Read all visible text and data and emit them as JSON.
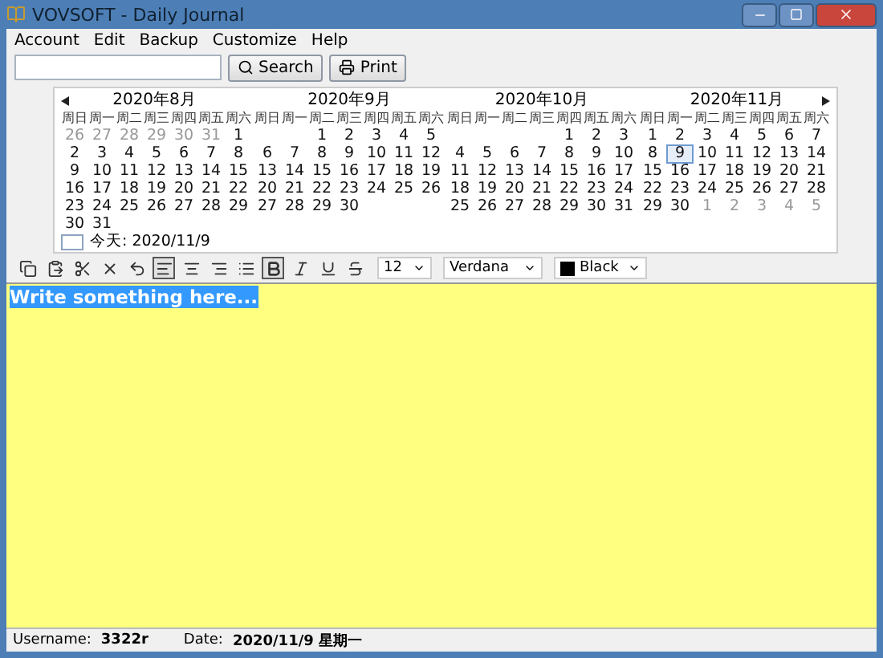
{
  "window": {
    "title": "VOVSOFT - Daily Journal"
  },
  "menu": [
    "Account",
    "Edit",
    "Backup",
    "Customize",
    "Help"
  ],
  "search": {
    "button": "Search"
  },
  "print_button": "Print",
  "calendar": {
    "months": [
      {
        "title": "2020年8月",
        "weekdays": [
          "周日",
          "周一",
          "周二",
          "周三",
          "周四",
          "周五",
          "周六"
        ],
        "weeks": [
          [
            {
              "day": "26",
              "other": true,
              "selected": false
            },
            {
              "day": "27",
              "other": true,
              "selected": false
            },
            {
              "day": "28",
              "other": true,
              "selected": false
            },
            {
              "day": "29",
              "other": true,
              "selected": false
            },
            {
              "day": "30",
              "other": true,
              "selected": false
            },
            {
              "day": "31",
              "other": true,
              "selected": false
            },
            {
              "day": "1",
              "other": false,
              "selected": false
            }
          ],
          [
            {
              "day": "2",
              "other": false,
              "selected": false
            },
            {
              "day": "3",
              "other": false,
              "selected": false
            },
            {
              "day": "4",
              "other": false,
              "selected": false
            },
            {
              "day": "5",
              "other": false,
              "selected": false
            },
            {
              "day": "6",
              "other": false,
              "selected": false
            },
            {
              "day": "7",
              "other": false,
              "selected": false
            },
            {
              "day": "8",
              "other": false,
              "selected": false
            }
          ],
          [
            {
              "day": "9",
              "other": false,
              "selected": false
            },
            {
              "day": "10",
              "other": false,
              "selected": false
            },
            {
              "day": "11",
              "other": false,
              "selected": false
            },
            {
              "day": "12",
              "other": false,
              "selected": false
            },
            {
              "day": "13",
              "other": false,
              "selected": false
            },
            {
              "day": "14",
              "other": false,
              "selected": false
            },
            {
              "day": "15",
              "other": false,
              "selected": false
            }
          ],
          [
            {
              "day": "16",
              "other": false,
              "selected": false
            },
            {
              "day": "17",
              "other": false,
              "selected": false
            },
            {
              "day": "18",
              "other": false,
              "selected": false
            },
            {
              "day": "19",
              "other": false,
              "selected": false
            },
            {
              "day": "20",
              "other": false,
              "selected": false
            },
            {
              "day": "21",
              "other": false,
              "selected": false
            },
            {
              "day": "22",
              "other": false,
              "selected": false
            }
          ],
          [
            {
              "day": "23",
              "other": false,
              "selected": false
            },
            {
              "day": "24",
              "other": false,
              "selected": false
            },
            {
              "day": "25",
              "other": false,
              "selected": false
            },
            {
              "day": "26",
              "other": false,
              "selected": false
            },
            {
              "day": "27",
              "other": false,
              "selected": false
            },
            {
              "day": "28",
              "other": false,
              "selected": false
            },
            {
              "day": "29",
              "other": false,
              "selected": false
            }
          ],
          [
            {
              "day": "30",
              "other": false,
              "selected": false
            },
            {
              "day": "31",
              "other": false,
              "selected": false
            }
          ]
        ]
      },
      {
        "title": "2020年9月",
        "weekdays": [
          "周日",
          "周一",
          "周二",
          "周三",
          "周四",
          "周五",
          "周六"
        ],
        "weeks": [
          [
            {
              "day": "1",
              "other": false,
              "selected": false
            },
            {
              "day": "2",
              "other": false,
              "selected": false
            },
            {
              "day": "3",
              "other": false,
              "selected": false
            },
            {
              "day": "4",
              "other": false,
              "selected": false
            },
            {
              "day": "5",
              "other": false,
              "selected": false
            }
          ],
          [
            {
              "day": "6",
              "other": false,
              "selected": false
            },
            {
              "day": "7",
              "other": false,
              "selected": false
            },
            {
              "day": "8",
              "other": false,
              "selected": false
            },
            {
              "day": "9",
              "other": false,
              "selected": false
            },
            {
              "day": "10",
              "other": false,
              "selected": false
            },
            {
              "day": "11",
              "other": false,
              "selected": false
            },
            {
              "day": "12",
              "other": false,
              "selected": false
            }
          ],
          [
            {
              "day": "13",
              "other": false,
              "selected": false
            },
            {
              "day": "14",
              "other": false,
              "selected": false
            },
            {
              "day": "15",
              "other": false,
              "selected": false
            },
            {
              "day": "16",
              "other": false,
              "selected": false
            },
            {
              "day": "17",
              "other": false,
              "selected": false
            },
            {
              "day": "18",
              "other": false,
              "selected": false
            },
            {
              "day": "19",
              "other": false,
              "selected": false
            }
          ],
          [
            {
              "day": "20",
              "other": false,
              "selected": false
            },
            {
              "day": "21",
              "other": false,
              "selected": false
            },
            {
              "day": "22",
              "other": false,
              "selected": false
            },
            {
              "day": "23",
              "other": false,
              "selected": false
            },
            {
              "day": "24",
              "other": false,
              "selected": false
            },
            {
              "day": "25",
              "other": false,
              "selected": false
            },
            {
              "day": "26",
              "other": false,
              "selected": false
            }
          ],
          [
            {
              "day": "27",
              "other": false,
              "selected": false
            },
            {
              "day": "28",
              "other": false,
              "selected": false
            },
            {
              "day": "29",
              "other": false,
              "selected": false
            },
            {
              "day": "30",
              "other": false,
              "selected": false
            }
          ]
        ]
      },
      {
        "title": "2020年10月",
        "weekdays": [
          "周日",
          "周一",
          "周二",
          "周三",
          "周四",
          "周五",
          "周六"
        ],
        "weeks": [
          [
            {
              "day": "1",
              "other": false,
              "selected": false
            },
            {
              "day": "2",
              "other": false,
              "selected": false
            },
            {
              "day": "3",
              "other": false,
              "selected": false
            }
          ],
          [
            {
              "day": "4",
              "other": false,
              "selected": false
            },
            {
              "day": "5",
              "other": false,
              "selected": false
            },
            {
              "day": "6",
              "other": false,
              "selected": false
            },
            {
              "day": "7",
              "other": false,
              "selected": false
            },
            {
              "day": "8",
              "other": false,
              "selected": false
            },
            {
              "day": "9",
              "other": false,
              "selected": false
            },
            {
              "day": "10",
              "other": false,
              "selected": false
            }
          ],
          [
            {
              "day": "11",
              "other": false,
              "selected": false
            },
            {
              "day": "12",
              "other": false,
              "selected": false
            },
            {
              "day": "13",
              "other": false,
              "selected": false
            },
            {
              "day": "14",
              "other": false,
              "selected": false
            },
            {
              "day": "15",
              "other": false,
              "selected": false
            },
            {
              "day": "16",
              "other": false,
              "selected": false
            },
            {
              "day": "17",
              "other": false,
              "selected": false
            }
          ],
          [
            {
              "day": "18",
              "other": false,
              "selected": false
            },
            {
              "day": "19",
              "other": false,
              "selected": false
            },
            {
              "day": "20",
              "other": false,
              "selected": false
            },
            {
              "day": "21",
              "other": false,
              "selected": false
            },
            {
              "day": "22",
              "other": false,
              "selected": false
            },
            {
              "day": "23",
              "other": false,
              "selected": false
            },
            {
              "day": "24",
              "other": false,
              "selected": false
            }
          ],
          [
            {
              "day": "25",
              "other": false,
              "selected": false
            },
            {
              "day": "26",
              "other": false,
              "selected": false
            },
            {
              "day": "27",
              "other": false,
              "selected": false
            },
            {
              "day": "28",
              "other": false,
              "selected": false
            },
            {
              "day": "29",
              "other": false,
              "selected": false
            },
            {
              "day": "30",
              "other": false,
              "selected": false
            },
            {
              "day": "31",
              "other": false,
              "selected": false
            }
          ]
        ]
      },
      {
        "title": "2020年11月",
        "weekdays": [
          "周日",
          "周一",
          "周二",
          "周三",
          "周四",
          "周五",
          "周六"
        ],
        "weeks": [
          [
            {
              "day": "1",
              "other": false,
              "selected": false
            },
            {
              "day": "2",
              "other": false,
              "selected": false
            },
            {
              "day": "3",
              "other": false,
              "selected": false
            },
            {
              "day": "4",
              "other": false,
              "selected": false
            },
            {
              "day": "5",
              "other": false,
              "selected": false
            },
            {
              "day": "6",
              "other": false,
              "selected": false
            },
            {
              "day": "7",
              "other": false,
              "selected": false
            }
          ],
          [
            {
              "day": "8",
              "other": false,
              "selected": false
            },
            {
              "day": "9",
              "other": false,
              "selected": true
            },
            {
              "day": "10",
              "other": false,
              "selected": false
            },
            {
              "day": "11",
              "other": false,
              "selected": false
            },
            {
              "day": "12",
              "other": false,
              "selected": false
            },
            {
              "day": "13",
              "other": false,
              "selected": false
            },
            {
              "day": "14",
              "other": false,
              "selected": false
            }
          ],
          [
            {
              "day": "15",
              "other": false,
              "selected": false
            },
            {
              "day": "16",
              "other": false,
              "selected": false
            },
            {
              "day": "17",
              "other": false,
              "selected": false
            },
            {
              "day": "18",
              "other": false,
              "selected": false
            },
            {
              "day": "19",
              "other": false,
              "selected": false
            },
            {
              "day": "20",
              "other": false,
              "selected": false
            },
            {
              "day": "21",
              "other": false,
              "selected": false
            }
          ],
          [
            {
              "day": "22",
              "other": false,
              "selected": false
            },
            {
              "day": "23",
              "other": false,
              "selected": false
            },
            {
              "day": "24",
              "other": false,
              "selected": false
            },
            {
              "day": "25",
              "other": false,
              "selected": false
            },
            {
              "day": "26",
              "other": false,
              "selected": false
            },
            {
              "day": "27",
              "other": false,
              "selected": false
            },
            {
              "day": "28",
              "other": false,
              "selected": false
            }
          ],
          [
            {
              "day": "29",
              "other": false,
              "selected": false
            },
            {
              "day": "30",
              "other": false,
              "selected": false
            },
            {
              "day": "1",
              "other": true,
              "selected": false
            },
            {
              "day": "2",
              "other": true,
              "selected": false
            },
            {
              "day": "3",
              "other": true,
              "selected": false
            },
            {
              "day": "4",
              "other": true,
              "selected": false
            },
            {
              "day": "5",
              "other": true,
              "selected": false
            }
          ]
        ]
      }
    ],
    "today": "今天: 2020/11/9"
  },
  "format_toolbar": {
    "tools": [
      {
        "kind": "copy",
        "on": false
      },
      {
        "kind": "paste",
        "on": false
      },
      {
        "kind": "cut",
        "on": false
      },
      {
        "kind": "delete",
        "on": false
      },
      {
        "kind": "undo",
        "on": false
      },
      {
        "kind": "align-left",
        "on": true
      },
      {
        "kind": "align-center",
        "on": false
      },
      {
        "kind": "align-right",
        "on": false
      },
      {
        "kind": "bullets",
        "on": false
      },
      {
        "kind": "bold",
        "on": true
      },
      {
        "kind": "italic",
        "on": false
      },
      {
        "kind": "underline",
        "on": false
      },
      {
        "kind": "strikethrough",
        "on": false
      }
    ],
    "font_size": "12",
    "font": "Verdana",
    "color": {
      "name": "Black",
      "color": "#000000"
    }
  },
  "editor": {
    "text": "Write something here...",
    "selected": true
  },
  "status_bar": {
    "username_label": "Username:",
    "username": "3322r",
    "date_label": "Date:",
    "date": "2020/11/9 星期一"
  }
}
